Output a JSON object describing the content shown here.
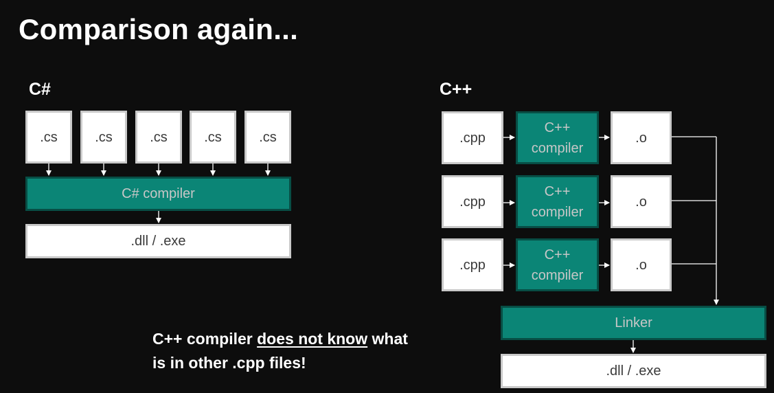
{
  "title": "Comparison again...",
  "csharp": {
    "label": "C#",
    "sources": [
      ".cs",
      ".cs",
      ".cs",
      ".cs",
      ".cs"
    ],
    "compiler": "C# compiler",
    "output": ".dll / .exe"
  },
  "cpp": {
    "label": "C++",
    "rows": [
      {
        "source": ".cpp",
        "compiler": "C++\ncompiler",
        "object": ".o"
      },
      {
        "source": ".cpp",
        "compiler": "C++\ncompiler",
        "object": ".o"
      },
      {
        "source": ".cpp",
        "compiler": "C++\ncompiler",
        "object": ".o"
      }
    ],
    "linker": "Linker",
    "output": ".dll / .exe"
  },
  "note": {
    "part1": "C++ compiler ",
    "emphasis": "does not know",
    "part2": " what",
    "line2": "is in other .cpp files!"
  },
  "colors": {
    "background": "#0d0d0d",
    "teal": "#0b8576",
    "box": "#ffffff"
  }
}
